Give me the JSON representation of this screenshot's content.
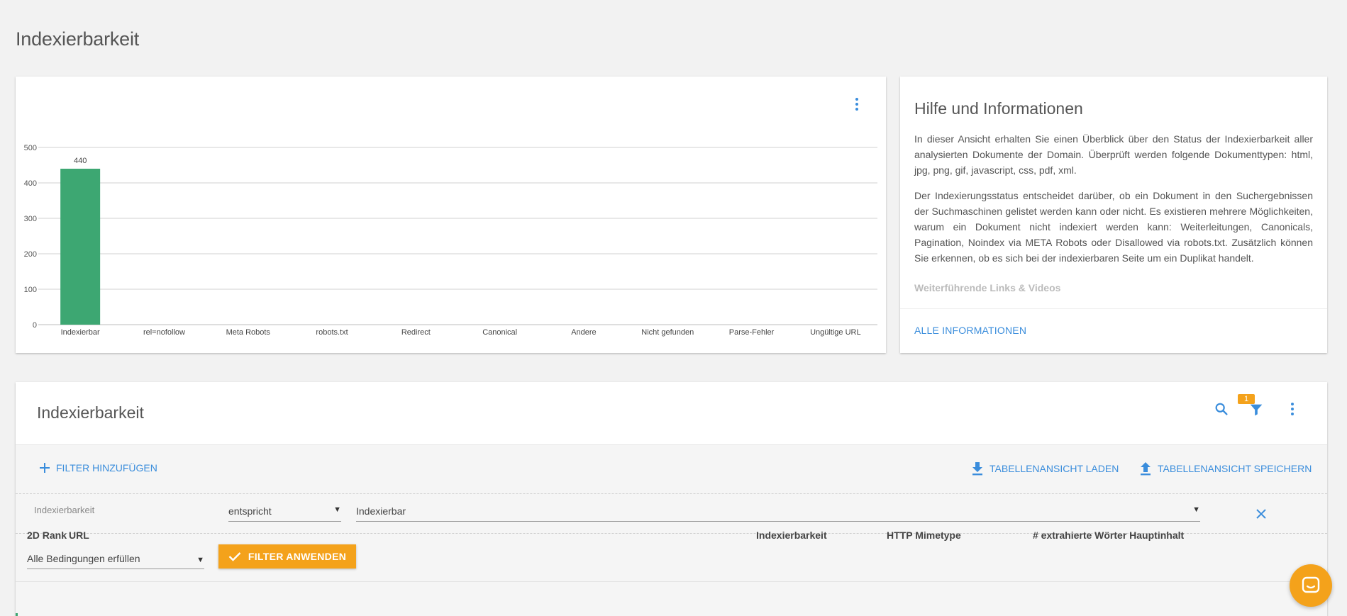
{
  "page": {
    "title": "Indexierbarkeit"
  },
  "chart_card": {
    "chart_data": {
      "type": "bar",
      "categories": [
        "Indexierbar",
        "rel=nofollow",
        "Meta Robots",
        "robots.txt",
        "Redirect",
        "Canonical",
        "Andere",
        "Nicht gefunden",
        "Parse-Fehler",
        "Ungültige URL"
      ],
      "values": [
        440,
        0,
        0,
        0,
        0,
        0,
        0,
        0,
        0,
        0
      ],
      "data_labels": [
        "440",
        "",
        "",
        "",
        "",
        "",
        "",
        "",
        "",
        ""
      ],
      "yticks": [
        0,
        100,
        200,
        300,
        400,
        500
      ],
      "ylim": [
        0,
        500
      ],
      "bar_color": "#3da772",
      "grid": true,
      "title": "",
      "xlabel": "",
      "ylabel": ""
    }
  },
  "help": {
    "title": "Hilfe und Informationen",
    "paragraph1": "In dieser Ansicht erhalten Sie einen Überblick über den Status der Indexierbarkeit aller analysierten Dokumente der Domain. Überprüft werden folgende Dokumenttypen: html, jpg, png, gif, javascript, css, pdf, xml.",
    "paragraph2": "Der Indexierungsstatus entscheidet darüber, ob ein Dokument in den Suchergebnissen der Suchmaschinen gelistet werden kann oder nicht. Es existieren mehrere Möglichkeiten, warum ein Dokument nicht indexiert werden kann: Weiterleitungen, Canonicals, Pagination, Noindex via META Robots oder Disallowed via robots.txt. Zusätzlich können Sie erkennen, ob es sich bei der indexierbaren Seite um ein Duplikat handelt.",
    "links_heading": "Weiterführende Links & Videos",
    "all_info": "ALLE INFORMATIONEN"
  },
  "table": {
    "title": "Indexierbarkeit",
    "filter_badge": "1",
    "add_filter": "FILTER HINZUFÜGEN",
    "load_view": "TABELLENANSICHT LADEN",
    "save_view": "TABELLENANSICHT SPEICHERN",
    "filter": {
      "field": "Indexierbarkeit",
      "operator": "entspricht",
      "value": "Indexierbar"
    },
    "condition": "Alle Bedingungen erfüllen",
    "apply": "FILTER ANWENDEN",
    "columns": [
      "2D Rank",
      "URL",
      "Indexierbarkeit",
      "HTTP Mimetype",
      "# extrahierte Wörter Hauptinhalt"
    ]
  },
  "colors": {
    "accent": "#3a8ddc",
    "orange": "#f4a21b",
    "bar": "#3da772"
  },
  "icons": {
    "search": "search-icon",
    "filter": "filter-icon",
    "more": "more-vert-icon",
    "download": "download-icon",
    "upload": "upload-icon",
    "close": "close-icon",
    "plus": "plus-icon",
    "check": "check-icon",
    "chat": "chat-icon"
  }
}
